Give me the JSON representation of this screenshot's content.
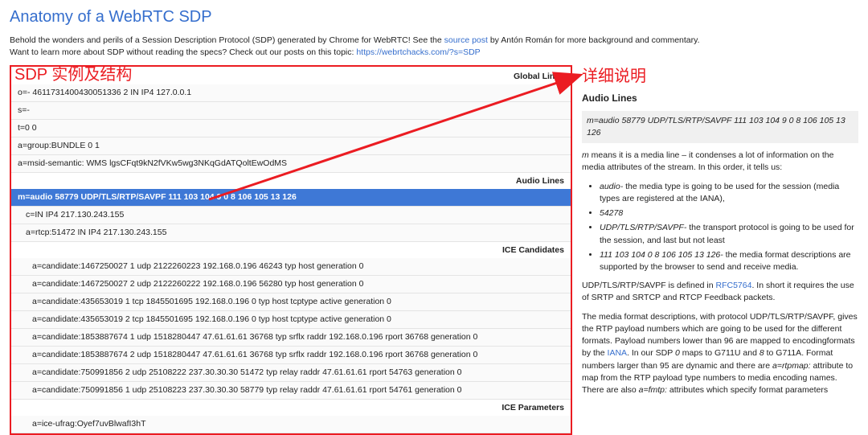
{
  "title": "Anatomy of a WebRTC SDP",
  "intro": {
    "line1a": "Behold the wonders and perils of a Session Description Protocol (SDP) generated by Chrome for WebRTC! See the ",
    "link1": "source post",
    "line1b": " by Antón Román for more background and commentary.",
    "line2a": "Want to learn more about SDP without reading the specs? Check out our posts on this topic: ",
    "link2": "https://webrtchacks.com/?s=SDP"
  },
  "labels": {
    "left": "SDP 实例及结构",
    "right": "详细说明"
  },
  "headers": {
    "global": "Global Lines",
    "audio": "Audio Lines",
    "ice_cand": "ICE Candidates",
    "ice_param": "ICE Parameters"
  },
  "rows": {
    "g1": "o=- 4611731400430051336 2 IN IP4 127.0.0.1",
    "g2": "s=-",
    "g3": "t=0 0",
    "g4": "a=group:BUNDLE 0 1",
    "g5": "a=msid-semantic: WMS lgsCFqt9kN2fVKw5wg3NKqGdATQoltEwOdMS",
    "a1": "m=audio 58779 UDP/TLS/RTP/SAVPF 111 103 104 9 0 8 106 105 13 126",
    "a2": "c=IN IP4 217.130.243.155",
    "a3": "a=rtcp:51472 IN IP4 217.130.243.155",
    "c1": "a=candidate:1467250027 1 udp 2122260223 192.168.0.196 46243 typ host generation 0",
    "c2": "a=candidate:1467250027 2 udp 2122260222 192.168.0.196 56280 typ host generation 0",
    "c3": "a=candidate:435653019 1 tcp 1845501695 192.168.0.196 0 typ host tcptype active generation 0",
    "c4": "a=candidate:435653019 2 tcp 1845501695 192.168.0.196 0 typ host tcptype active generation 0",
    "c5": "a=candidate:1853887674 1 udp 1518280447 47.61.61.61 36768 typ srflx raddr 192.168.0.196 rport 36768 generation 0",
    "c6": "a=candidate:1853887674 2 udp 1518280447 47.61.61.61 36768 typ srflx raddr 192.168.0.196 rport 36768 generation 0",
    "c7": "a=candidate:750991856 2 udp 25108222 237.30.30.30 51472 typ relay raddr 47.61.61.61 rport 54763 generation 0",
    "c8": "a=candidate:750991856 1 udp 25108223 237.30.30.30 58779 typ relay raddr 47.61.61.61 rport 54761 generation 0",
    "p1": "a=ice-ufrag:Oyef7uvBlwafI3hT"
  },
  "detail": {
    "header": "Audio Lines",
    "line": "m=audio 58779 UDP/TLS/RTP/SAVPF 111 103 104 9 0 8 106 105 13 126",
    "p1a": "m",
    "p1b": " means it is a media line – it condenses a lot of information on the media attributes of the stream. In this order, it tells us:",
    "li1a": "audio-",
    "li1b": " the media type is going to be used for the session (media types are registered at the IANA),",
    "li2": "54278",
    "li3a": "UDP/TLS/RTP/SAVPF-",
    "li3b": " the transport protocol is going to be used for the session, and last but not least",
    "li4a": "111 103 104 0 8 106 105 13 126-",
    "li4b": " the media format descriptions are supported by the browser to send and receive media.",
    "p2a": "UDP/TLS/RTP/SAVPF is defined in ",
    "p2link": "RFC5764",
    "p2b": ". In short it requires the use of SRTP and SRTCP and RTCP Feedback packets.",
    "p3a": "The media format descriptions, with protocol UDP/TLS/RTP/SAVPF, gives the RTP payload numbers which are going to be used for the different formats.  Payload numbers lower than 96 are mapped to encodingformats by the ",
    "p3link": "IANA",
    "p3b": ". In our SDP ",
    "p3c": "0",
    "p3d": " maps to G711U and ",
    "p3e": "8",
    "p3f": " to G711A. Format numbers larger than 95 are dynamic and there are ",
    "p3g": "a=rtpmap:",
    "p3h": " attribute to map from the RTP payload type numbers to media encoding names.  There are also ",
    "p3i": "a=fmtp:",
    "p3j": " attributes which specify format parameters"
  }
}
